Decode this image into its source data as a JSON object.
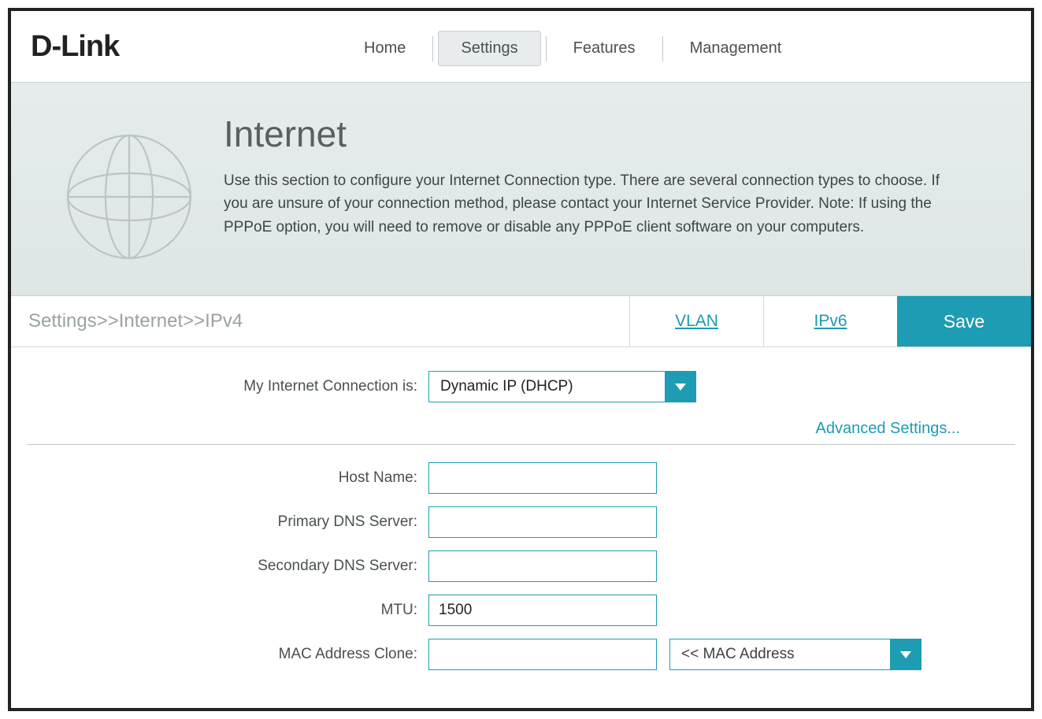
{
  "logo": "D-Link",
  "nav": {
    "home": "Home",
    "settings": "Settings",
    "features": "Features",
    "management": "Management"
  },
  "page": {
    "title": "Internet",
    "description": "Use this section to configure your Internet Connection type. There are several connection types to choose. If you are unsure of your connection method, please contact your Internet Service Provider. Note: If using the PPPoE option, you will need to remove or disable any PPPoE client software on your computers."
  },
  "breadcrumb": "Settings>>Internet>>IPv4",
  "tabs": {
    "vlan": "VLAN",
    "ipv6": "IPv6",
    "save": "Save"
  },
  "form": {
    "connection_label": "My Internet Connection is:",
    "connection_value": "Dynamic IP (DHCP)",
    "advanced_link": "Advanced Settings...",
    "host_name_label": "Host Name:",
    "host_name_value": "",
    "primary_dns_label": "Primary DNS Server:",
    "primary_dns_value": "",
    "secondary_dns_label": "Secondary DNS Server:",
    "secondary_dns_value": "",
    "mtu_label": "MTU:",
    "mtu_value": "1500",
    "mac_clone_label": "MAC Address Clone:",
    "mac_clone_value": "",
    "mac_select_value": "<< MAC Address"
  }
}
